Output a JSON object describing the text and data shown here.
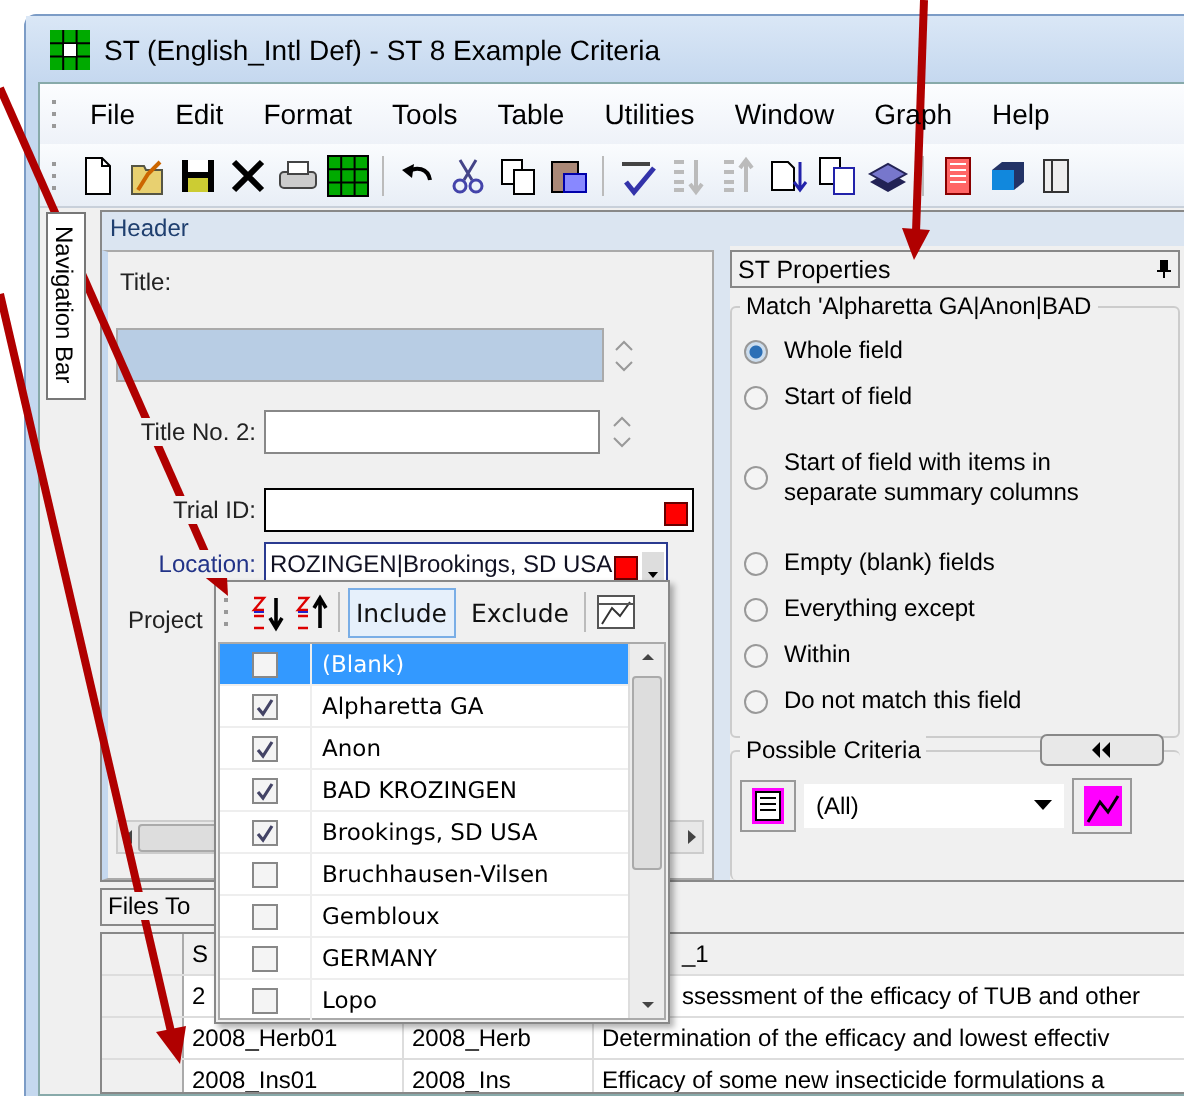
{
  "window": {
    "title": "ST (English_Intl Def) - ST 8 Example Criteria"
  },
  "menu": [
    {
      "label": "File"
    },
    {
      "label": "Edit"
    },
    {
      "label": "Format"
    },
    {
      "label": "Tools"
    },
    {
      "label": "Table"
    },
    {
      "label": "Utilities"
    },
    {
      "label": "Window"
    },
    {
      "label": "Graph"
    },
    {
      "label": "Help"
    }
  ],
  "navigation_bar": {
    "label": "Navigation Bar"
  },
  "header": {
    "title": "Header",
    "fields": [
      {
        "kind": "area",
        "label": "Title:",
        "flagged": false
      },
      {
        "kind": "spin",
        "label": "Title No. 2:",
        "flagged": false
      },
      {
        "kind": "text",
        "label": "Trial ID:",
        "flagged": true
      },
      {
        "kind": "combo",
        "label": "Location:",
        "value": "ROZINGEN|Brookings, SD USA",
        "flagged": true
      },
      {
        "kind": "label",
        "label": "Project"
      }
    ]
  },
  "filter_dropdown": {
    "buttons": [
      {
        "label": "Include",
        "selected": true
      },
      {
        "label": "Exclude",
        "selected": false
      }
    ],
    "items": [
      {
        "label": "(Blank)",
        "checked": false,
        "selected": true
      },
      {
        "label": "Alpharetta GA",
        "checked": true,
        "selected": false
      },
      {
        "label": "Anon",
        "checked": true,
        "selected": false
      },
      {
        "label": "BAD KROZINGEN",
        "checked": true,
        "selected": false
      },
      {
        "label": "Brookings, SD USA",
        "checked": true,
        "selected": false
      },
      {
        "label": "Bruchhausen-Vilsen",
        "checked": false,
        "selected": false
      },
      {
        "label": "Gembloux",
        "checked": false,
        "selected": false
      },
      {
        "label": "GERMANY",
        "checked": false,
        "selected": false
      },
      {
        "label": "Lopo",
        "checked": false,
        "selected": false
      }
    ]
  },
  "properties": {
    "title": "ST Properties",
    "match_group": {
      "title": "Match 'Alpharetta GA|Anon|BAD",
      "options": [
        {
          "label": "Whole field",
          "selected": true
        },
        {
          "label": "Start of field",
          "selected": false
        },
        {
          "label": "Start of field with items in separate summary columns",
          "selected": false
        },
        {
          "label": "Empty (blank) fields",
          "selected": false
        },
        {
          "label": "Everything except",
          "selected": false
        },
        {
          "label": "Within",
          "selected": false
        },
        {
          "label": "Do not match this field",
          "selected": false
        }
      ]
    },
    "criteria_group": {
      "title": "Possible Criteria",
      "combo": {
        "value": "(All)"
      }
    }
  },
  "files_panel": {
    "title": "Files To",
    "columns": [
      {
        "label": "S"
      },
      {},
      {
        "label": "_1"
      }
    ],
    "rows": [
      {
        "cells": [
          "2",
          null,
          "ssessment of the efficacy of TUB and other"
        ]
      },
      {
        "cells": [
          "2008_Herb01",
          "2008_Herb",
          "Determination of the efficacy and lowest effectiv"
        ]
      },
      {
        "cells": [
          "2008_Ins01",
          "2008_Ins",
          "Efficacy of some new insecticide formulations a"
        ]
      }
    ]
  }
}
